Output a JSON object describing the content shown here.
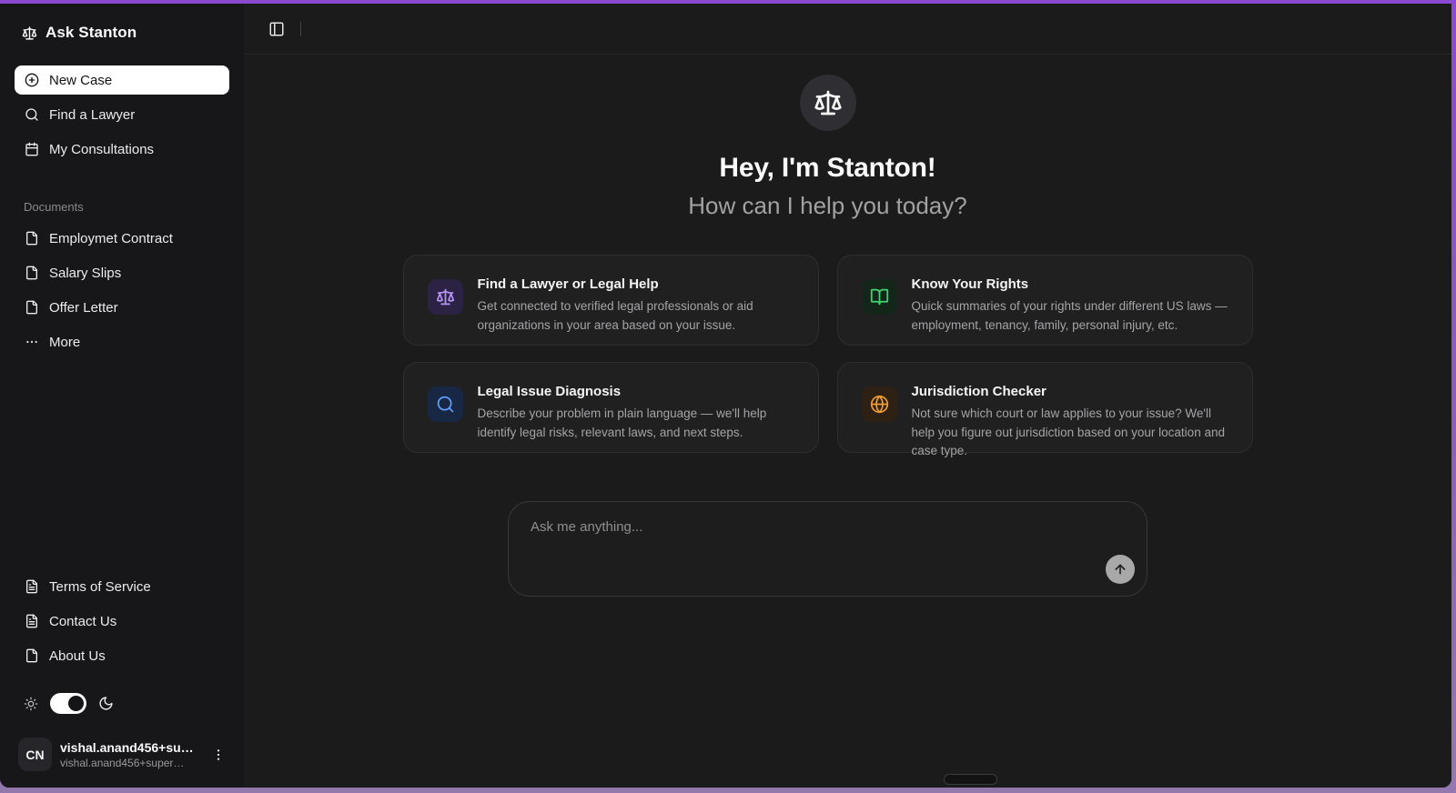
{
  "app": {
    "title": "Ask Stanton",
    "frame_accent_color": "#8b49d2"
  },
  "sidebar": {
    "brand": "Ask Stanton",
    "brand_icon": "scale-icon",
    "nav": [
      {
        "label": "New Case",
        "icon": "circle-plus-icon",
        "active": true
      },
      {
        "label": "Find a Lawyer",
        "icon": "search-icon",
        "active": false
      },
      {
        "label": "My Consultations",
        "icon": "calendar-icon",
        "active": false
      }
    ],
    "documents": {
      "heading": "Documents",
      "items": [
        {
          "label": "Employmet Contract",
          "icon": "file-icon"
        },
        {
          "label": "Salary Slips",
          "icon": "file-icon"
        },
        {
          "label": "Offer Letter",
          "icon": "file-icon"
        },
        {
          "label": "More",
          "icon": "ellipsis-icon"
        }
      ]
    },
    "footer_links": [
      {
        "label": "Terms of Service",
        "icon": "file-text-icon"
      },
      {
        "label": "Contact Us",
        "icon": "file-text-icon"
      },
      {
        "label": "About Us",
        "icon": "file-icon"
      }
    ],
    "theme_toggle": {
      "state": "on",
      "left_icon": "sun-icon",
      "right_icon": "moon-icon"
    },
    "user": {
      "initials": "CN",
      "name": "vishal.anand456+su…",
      "email": "vishal.anand456+super…",
      "menu_icon": "kebab-icon"
    }
  },
  "main": {
    "topbar": {
      "toggle_icon": "panel-left-icon"
    },
    "hero": {
      "logo_icon": "scale-icon",
      "title": "Hey, I'm Stanton!",
      "subtitle": "How can I help you today?"
    },
    "cards": [
      {
        "title": "Find a Lawyer or Legal Help",
        "description": "Get connected to verified legal professionals or aid organizations in your area based on your issue.",
        "icon": "scale-icon",
        "accent": "#b794f6"
      },
      {
        "title": "Know Your Rights",
        "description": "Quick summaries of your rights under different US laws — employment, tenancy, family, personal injury, etc.",
        "icon": "book-open-icon",
        "accent": "#3fd776"
      },
      {
        "title": "Legal Issue Diagnosis",
        "description": "Describe your problem in plain language — we'll help identify legal risks, relevant laws, and next steps.",
        "icon": "search-icon",
        "accent": "#5f9df8"
      },
      {
        "title": "Jurisdiction Checker",
        "description": "Not sure which court or law applies to your issue? We'll help you figure out jurisdiction based on your location and case type.",
        "icon": "globe-icon",
        "accent": "#ef9b33"
      }
    ],
    "composer": {
      "placeholder": "Ask me anything...",
      "send_icon": "arrow-up-icon"
    }
  }
}
